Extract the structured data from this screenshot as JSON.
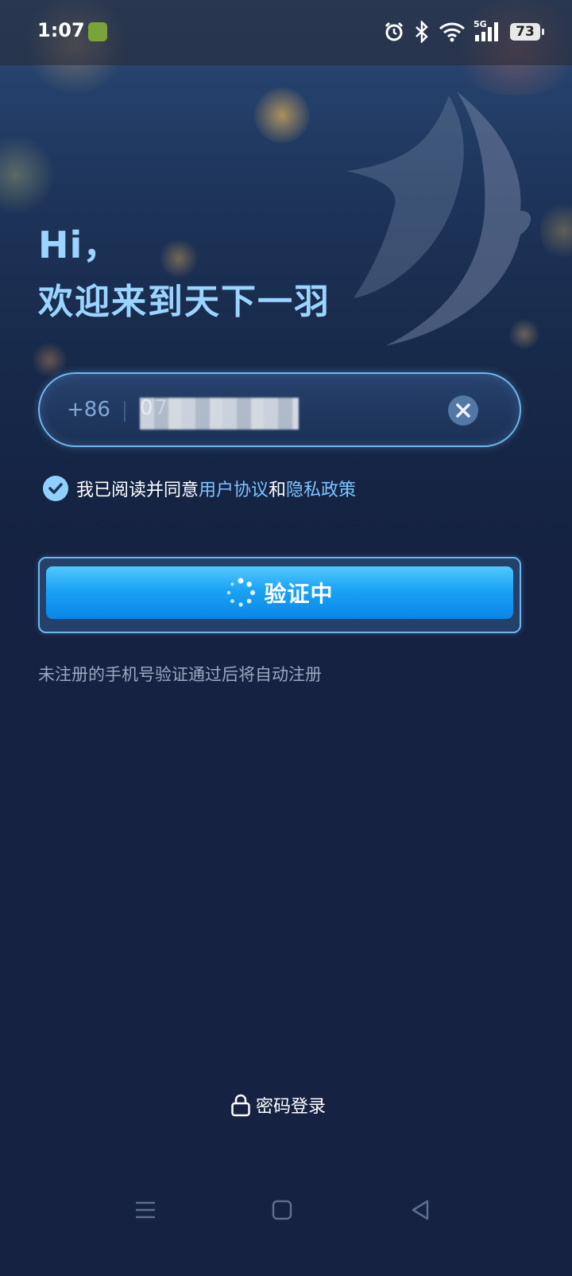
{
  "status_bar": {
    "time": "1:07",
    "network": "5G",
    "battery": "73"
  },
  "greeting": {
    "hi": "Hi，",
    "welcome": "欢迎来到天下一羽"
  },
  "phone_input": {
    "country_code": "+86",
    "value": "07"
  },
  "agreement": {
    "prefix": "我已阅读并同意",
    "user_agreement": "用户协议",
    "and": "和",
    "privacy_policy": "隐私政策",
    "checked": true
  },
  "verify_button": {
    "label": "验证中"
  },
  "note": "未注册的手机号验证通过后将自动注册",
  "password_login": {
    "label": "密码登录"
  },
  "colors": {
    "background": "#152242",
    "accent": "#9ad4ff",
    "link": "#7cc5ff",
    "button": "#1aa3f5"
  }
}
